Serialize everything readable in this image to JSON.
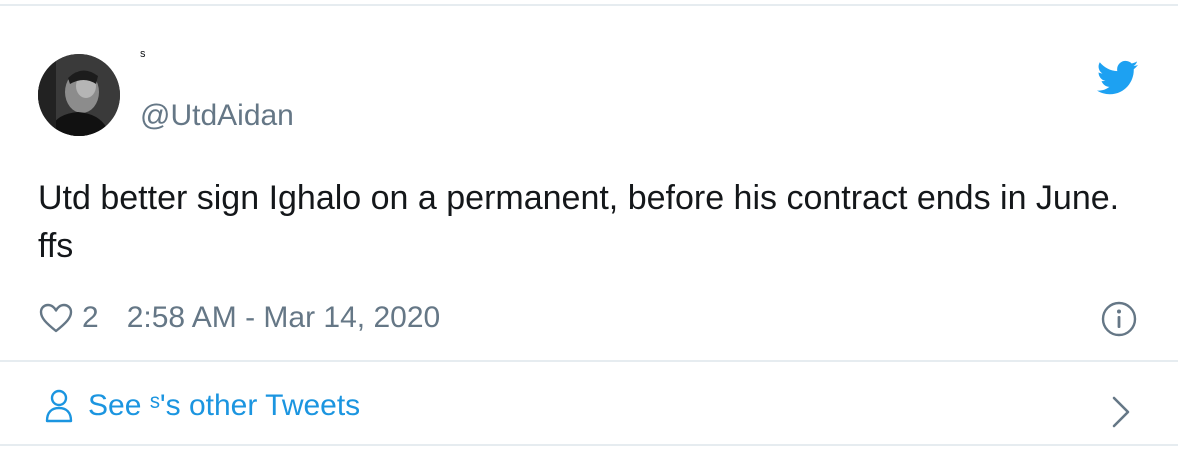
{
  "tweet": {
    "display_name": "ˢ",
    "handle": "@UtdAidan",
    "text": "Utd better sign Ighalo on a permanent, before his contract ends in June. ffs",
    "likes": "2",
    "timestamp": "2:58 AM - Mar 14, 2020"
  },
  "footer": {
    "link_label": "See ˢ's other Tweets"
  },
  "colors": {
    "twitter_blue": "#1da1f2",
    "link_blue": "#1b95e0",
    "muted_gray": "#657786",
    "border": "#e6ecf0"
  },
  "icons": {
    "brand": "twitter-bird-icon",
    "like": "heart-icon",
    "info": "info-icon",
    "profile": "person-icon",
    "next": "chevron-right-icon"
  }
}
